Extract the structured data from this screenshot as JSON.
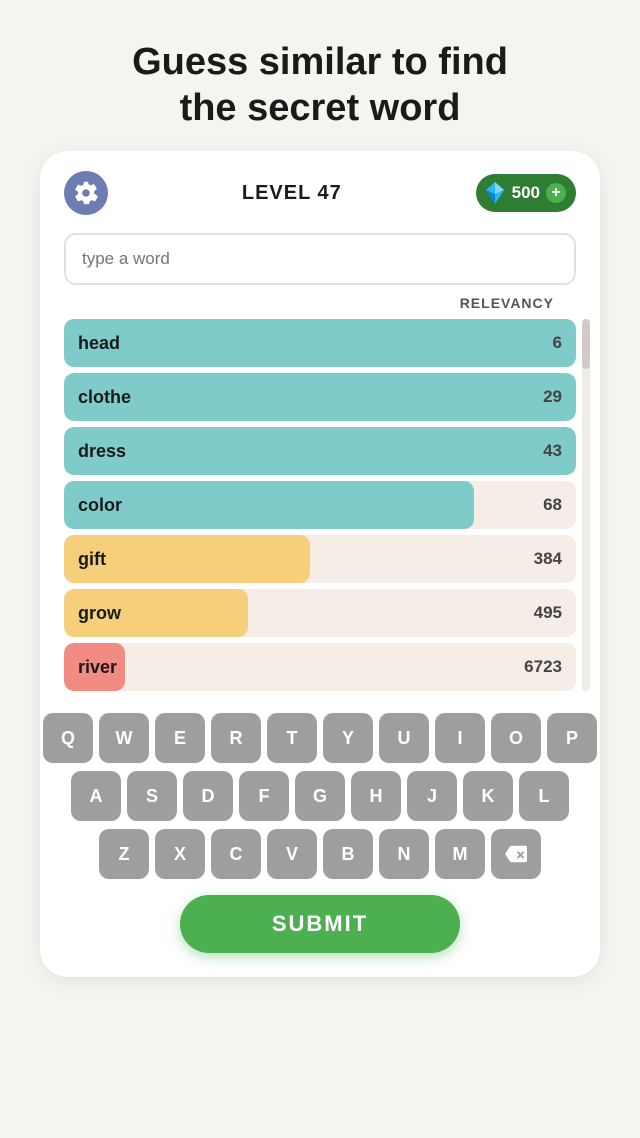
{
  "page": {
    "title_line1": "Guess similar to find",
    "title_line2": "the secret word"
  },
  "header": {
    "level_label": "LEVEL 47",
    "gems": "500",
    "gems_plus": "+"
  },
  "input": {
    "placeholder": "type a word"
  },
  "relevancy_label": "RELEVANCY",
  "words": [
    {
      "word": "head",
      "score": "6",
      "bar_pct": 100,
      "color": "#7ecbca"
    },
    {
      "word": "clothe",
      "score": "29",
      "bar_pct": 100,
      "color": "#7ecbca"
    },
    {
      "word": "dress",
      "score": "43",
      "bar_pct": 100,
      "color": "#7ecbca"
    },
    {
      "word": "color",
      "score": "68",
      "bar_pct": 80,
      "color": "#7ecbca"
    },
    {
      "word": "gift",
      "score": "384",
      "bar_pct": 48,
      "color": "#f5cf7a"
    },
    {
      "word": "grow",
      "score": "495",
      "bar_pct": 36,
      "color": "#f5cf7a"
    },
    {
      "word": "river",
      "score": "6723",
      "bar_pct": 12,
      "color": "#f28b82"
    }
  ],
  "keyboard": {
    "rows": [
      [
        "Q",
        "W",
        "E",
        "R",
        "T",
        "Y",
        "U",
        "I",
        "O",
        "P"
      ],
      [
        "A",
        "S",
        "D",
        "F",
        "G",
        "H",
        "J",
        "K",
        "L"
      ],
      [
        "Z",
        "X",
        "C",
        "V",
        "B",
        "N",
        "M",
        "⌫"
      ]
    ]
  },
  "submit_label": "SUBMIT"
}
